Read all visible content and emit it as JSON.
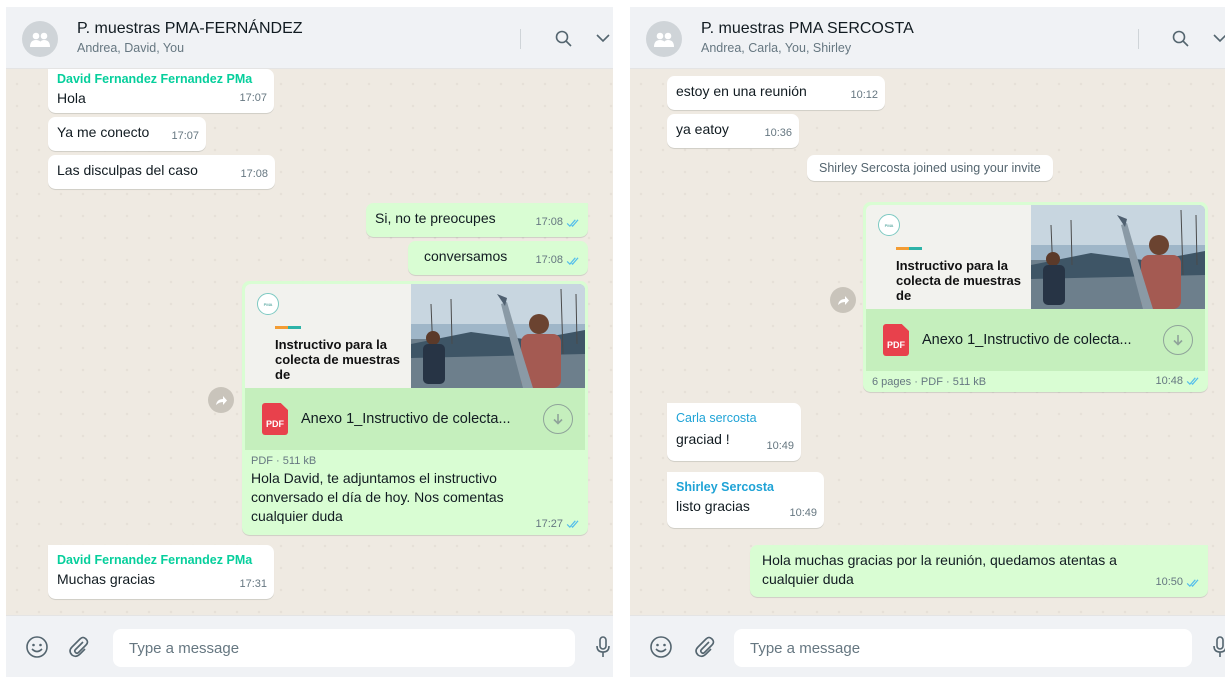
{
  "colors": {
    "incoming_bubble": "#ffffff",
    "outgoing_bubble": "#d9fdd3",
    "chat_background": "#efeae2",
    "read_ticks": "#53bdeb",
    "sender_green": "#06cf9c",
    "sender_blue": "#1fa3d6",
    "pdf_red": "#e8414c"
  },
  "icons": {
    "avatar": "group-avatar-icon",
    "search": "search-icon",
    "menu": "chevron-down-icon",
    "emoji": "emoji-icon",
    "attach": "paperclip-icon",
    "mic": "microphone-icon",
    "forward": "forward-icon",
    "download": "download-icon",
    "read": "double-check-icon"
  },
  "left": {
    "header": {
      "title": "P. muestras PMA-FERNÁNDEZ",
      "subtitle": "Andrea, David, You"
    },
    "messages": {
      "m1": {
        "sender": "David Fernandez Fernandez PMa",
        "text": "Hola",
        "time": "17:07"
      },
      "m2": {
        "text": "Ya me conecto",
        "time": "17:07"
      },
      "m3": {
        "text": "Las disculpas del caso",
        "time": "17:08"
      },
      "m4": {
        "text": "Si, no te preocupes",
        "time": "17:08"
      },
      "m5": {
        "text": "conversamos",
        "time": "17:08"
      },
      "doc": {
        "thumb_title": "Instructivo para la colecta de muestras de",
        "file_name": "Anexo 1_Instructivo de colecta...",
        "badge": "PDF",
        "info": "PDF · 511 kB",
        "caption": "Hola David, te adjuntamos el instructivo conversado el día de hoy. Nos comentas cualquier duda",
        "time": "17:27"
      },
      "m6": {
        "sender": "David Fernandez Fernandez PMa",
        "text": "Muchas gracias",
        "time": "17:31"
      }
    },
    "footer": {
      "placeholder": "Type a message"
    }
  },
  "right": {
    "header": {
      "title": "P. muestras PMA SERCOSTA",
      "subtitle": "Andrea, Carla, You, Shirley"
    },
    "messages": {
      "m1": {
        "text": "estoy en una reunión",
        "time": "10:12"
      },
      "m2": {
        "text": "ya eatoy",
        "time": "10:36"
      },
      "system": "Shirley Sercosta joined using your invite",
      "doc": {
        "thumb_title": "Instructivo para la colecta de muestras de",
        "file_name": "Anexo 1_Instructivo de colecta...",
        "badge": "PDF",
        "info": "6 pages · PDF · 511 kB",
        "time": "10:48"
      },
      "m3": {
        "sender": "Carla sercosta",
        "text": "graciad !",
        "time": "10:49"
      },
      "m4": {
        "sender": "Shirley Sercosta",
        "text": "listo gracias",
        "time": "10:49"
      },
      "m5": {
        "text": "Hola muchas gracias por la reunión, quedamos atentas a cualquier duda",
        "time": "10:50"
      }
    },
    "footer": {
      "placeholder": "Type a message"
    }
  }
}
